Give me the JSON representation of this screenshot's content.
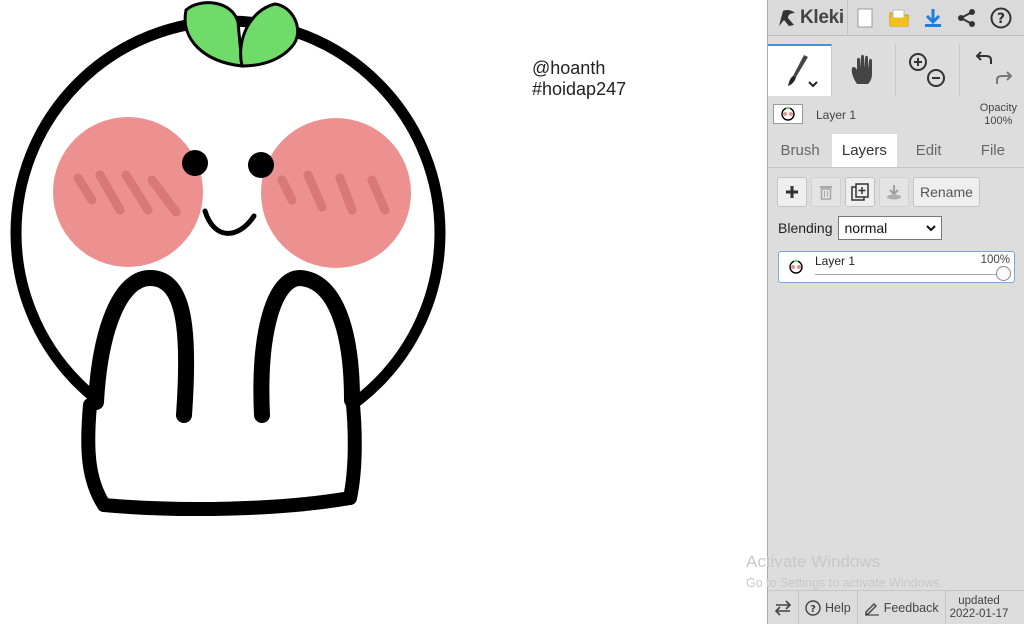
{
  "canvas": {
    "watermark_line1": "@hoanth",
    "watermark_line2": "#hoidap247"
  },
  "topbar": {
    "app_name": "Kleki",
    "icons": [
      "new-image-icon",
      "open-folder-icon",
      "download-icon",
      "share-icon",
      "help-icon"
    ]
  },
  "tools": [
    "brush-tool-icon",
    "hand-tool-icon",
    "zoom-icon",
    "undo-redo-icon"
  ],
  "layer_info": {
    "name": "Layer 1",
    "opacity_label": "Opacity",
    "opacity_value": "100%"
  },
  "tabs": [
    {
      "label": "Brush",
      "active": false
    },
    {
      "label": "Layers",
      "active": true
    },
    {
      "label": "Edit",
      "active": false
    },
    {
      "label": "File",
      "active": false
    }
  ],
  "layers_panel": {
    "rename_label": "Rename",
    "blending_label": "Blending",
    "blending_value": "normal",
    "layers": [
      {
        "name": "Layer 1",
        "opacity": "100%",
        "opacity_fraction": 1.0
      }
    ]
  },
  "bottombar": {
    "help_label": "Help",
    "feedback_label": "Feedback",
    "updated_label": "updated",
    "updated_date": "2022-01-17"
  },
  "overlay": {
    "activate_title": "Activate Windows",
    "activate_subtitle": "Go to Settings to activate Windows."
  },
  "colors": {
    "leaf": "#6fdc6a",
    "cheek": "#ec9090",
    "accent": "#4a90d9",
    "download": "#1a7fe0",
    "folder": "#f2c21b"
  }
}
